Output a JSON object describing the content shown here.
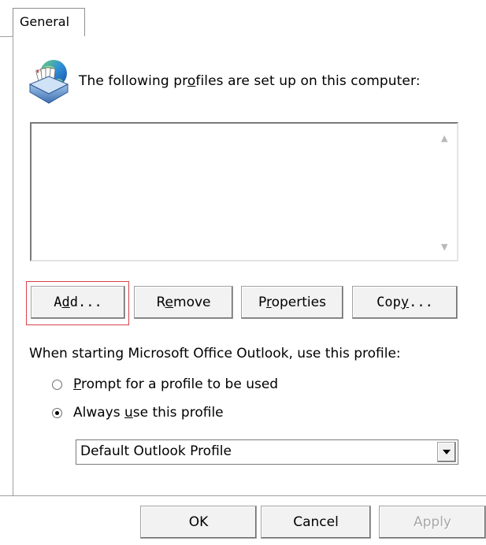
{
  "tabs": [
    {
      "label": "General"
    }
  ],
  "header": {
    "icon": "profiles-icon",
    "text_before": "The following pr",
    "text_mnemonic": "o",
    "text_after": "files are set up on this computer:"
  },
  "profile_list": {
    "items": []
  },
  "buttons": {
    "add": {
      "pre": "A",
      "mnemonic": "d",
      "post": "d..."
    },
    "remove": {
      "pre": "R",
      "mnemonic": "e",
      "post": "move"
    },
    "properties": {
      "pre": "P",
      "mnemonic": "r",
      "post": "operties"
    },
    "copy": {
      "pre": "Cop",
      "mnemonic": "y",
      "post": "..."
    }
  },
  "startup": {
    "label": "When starting Microsoft Office Outlook, use this profile:",
    "option_prompt": {
      "mnemonic": "P",
      "rest": "rompt for a profile to be used",
      "checked": false
    },
    "option_always": {
      "pre": "Always ",
      "mnemonic": "u",
      "post": "se this profile",
      "checked": true
    },
    "selected_profile": "Default Outlook Profile"
  },
  "footer": {
    "ok_label": "OK",
    "cancel_label": "Cancel",
    "apply_label": "Apply",
    "apply_enabled": false
  },
  "colors": {
    "highlight": "#d9434a",
    "button_face": "#f2f2f2",
    "border": "#a0a0a0"
  }
}
